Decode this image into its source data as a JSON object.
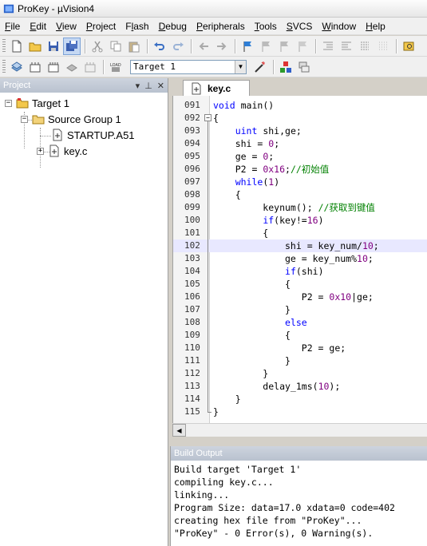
{
  "window": {
    "title": "ProKey  - µVision4"
  },
  "menu": [
    {
      "label": "File",
      "u": "F",
      "rest": "ile"
    },
    {
      "label": "Edit",
      "u": "E",
      "rest": "dit"
    },
    {
      "label": "View",
      "u": "V",
      "rest": "iew"
    },
    {
      "label": "Project",
      "u": "P",
      "rest": "roject"
    },
    {
      "label": "Flash",
      "u": "l",
      "pre": "F",
      "rest": "ash"
    },
    {
      "label": "Debug",
      "u": "D",
      "rest": "ebug"
    },
    {
      "label": "Peripherals",
      "u": "P",
      "rest": "eripherals"
    },
    {
      "label": "Tools",
      "u": "T",
      "rest": "ools"
    },
    {
      "label": "SVCS",
      "u": "S",
      "rest": "VCS"
    },
    {
      "label": "Window",
      "u": "W",
      "rest": "indow"
    },
    {
      "label": "Help",
      "u": "H",
      "rest": "elp"
    }
  ],
  "toolbar2": {
    "target_value": "Target 1"
  },
  "project": {
    "header": "Project",
    "tree": {
      "target": "Target 1",
      "group": "Source Group 1",
      "files": [
        "STARTUP.A51",
        "key.c"
      ]
    }
  },
  "editor": {
    "tab_label": "key.c",
    "lines": [
      {
        "n": "091",
        "code": "void main()"
      },
      {
        "n": "092",
        "code": "{"
      },
      {
        "n": "093",
        "code": "    uint shi,ge;"
      },
      {
        "n": "094",
        "code": "    shi = 0;"
      },
      {
        "n": "095",
        "code": "    ge = 0;"
      },
      {
        "n": "096",
        "code": "    P2 = 0x16;//初始值"
      },
      {
        "n": "097",
        "code": "    while(1)"
      },
      {
        "n": "098",
        "code": "    {"
      },
      {
        "n": "099",
        "code": "         keynum(); //获取到键值"
      },
      {
        "n": "100",
        "code": "         if(key!=16)"
      },
      {
        "n": "101",
        "code": "         {"
      },
      {
        "n": "102",
        "code": "             shi = key_num/10;"
      },
      {
        "n": "103",
        "code": "             ge = key_num%10;"
      },
      {
        "n": "104",
        "code": "             if(shi)"
      },
      {
        "n": "105",
        "code": "             {"
      },
      {
        "n": "106",
        "code": "                P2 = 0x10|ge;"
      },
      {
        "n": "107",
        "code": "             }"
      },
      {
        "n": "108",
        "code": "             else"
      },
      {
        "n": "109",
        "code": "             {"
      },
      {
        "n": "110",
        "code": "                P2 = ge;"
      },
      {
        "n": "111",
        "code": "             }"
      },
      {
        "n": "112",
        "code": "         }"
      },
      {
        "n": "113",
        "code": "         delay_1ms(10);"
      },
      {
        "n": "114",
        "code": "    }"
      },
      {
        "n": "115",
        "code": "}"
      }
    ],
    "highlight_line": "102"
  },
  "build": {
    "header": "Build Output",
    "lines": [
      "Build target 'Target 1'",
      "compiling key.c...",
      "linking...",
      "Program Size: data=17.0 xdata=0 code=402",
      "creating hex file from \"ProKey\"...",
      "\"ProKey\" - 0 Error(s), 0 Warning(s)."
    ]
  }
}
